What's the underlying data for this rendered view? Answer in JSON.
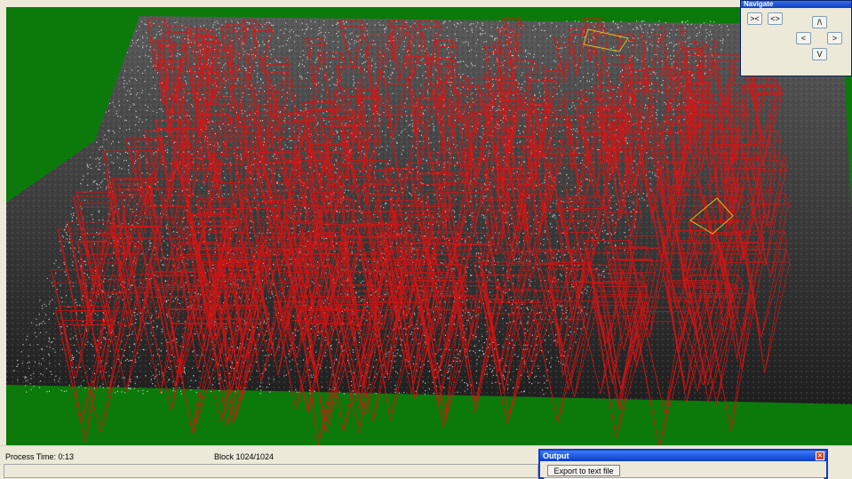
{
  "navigate": {
    "title": "Navigate",
    "buttons": {
      "zoom_in": "><",
      "zoom_out": "<>",
      "up": "/\\",
      "left": "<",
      "right": ">",
      "down": "V"
    }
  },
  "status": {
    "process_time": "Process Time: 0:13",
    "block": "Block 1024/1024"
  },
  "output": {
    "title": "Output",
    "close_glyph": "×",
    "export_button": "Export to text file"
  },
  "colors": {
    "background_green": "#0b7a0b",
    "terrain": "#3a3a3a",
    "point_cloud": "#e8e8e8",
    "camera_frustum": "#e01010",
    "highlight_frustum": "#d9c21a",
    "window_chrome": "#ece9d8",
    "title_blue": "#0a3fc4"
  },
  "icons": {
    "close": "close-icon"
  }
}
